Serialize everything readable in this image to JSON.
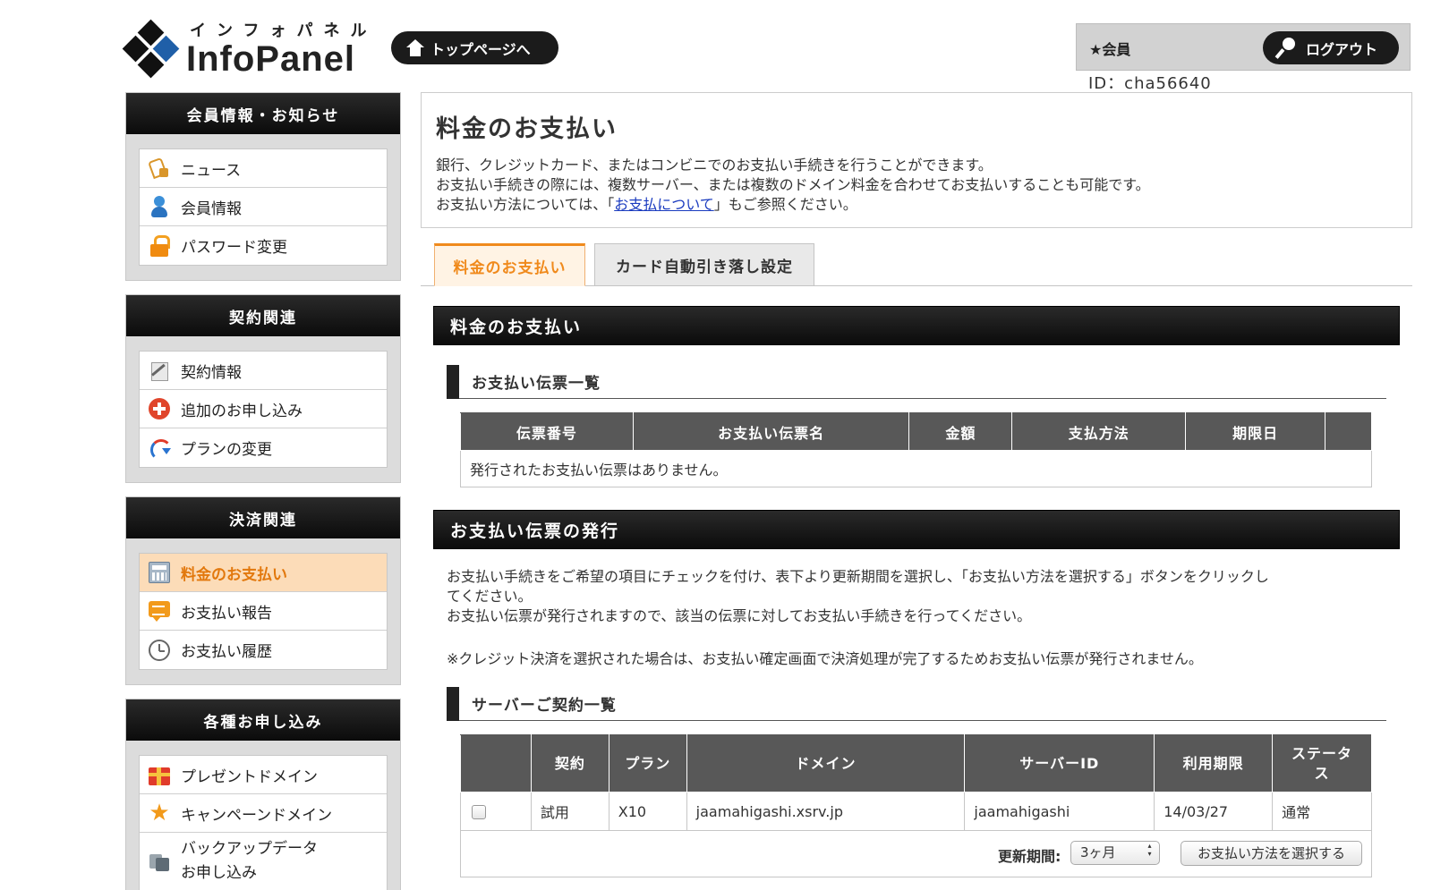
{
  "header": {
    "logo_kana": "インフォパネル",
    "logo_text": "InfoPanel",
    "top_button": "トップページへ",
    "member_label": "★会員",
    "logout_button": "ログアウト",
    "member_id": "ID：cha56640"
  },
  "sidebar": [
    {
      "title": "会員情報・お知らせ",
      "items": [
        {
          "label": "ニュース",
          "icon": "news-icon"
        },
        {
          "label": "会員情報",
          "icon": "user-icon"
        },
        {
          "label": "パスワード変更",
          "icon": "lock-icon"
        }
      ]
    },
    {
      "title": "契約関連",
      "items": [
        {
          "label": "契約情報",
          "icon": "contract-icon"
        },
        {
          "label": "追加のお申し込み",
          "icon": "plus-icon"
        },
        {
          "label": "プランの変更",
          "icon": "swap-icon"
        }
      ]
    },
    {
      "title": "決済関連",
      "items": [
        {
          "label": "料金のお支払い",
          "icon": "calculator-icon",
          "active": true
        },
        {
          "label": "お支払い報告",
          "icon": "chat-icon"
        },
        {
          "label": "お支払い履歴",
          "icon": "clock-icon"
        }
      ]
    },
    {
      "title": "各種お申し込み",
      "items": [
        {
          "label": "プレゼントドメイン",
          "icon": "gift-icon"
        },
        {
          "label": "キャンペーンドメイン",
          "icon": "star-icon"
        },
        {
          "label_line1": "バックアップデータ",
          "label_line2": "お申し込み",
          "icon": "backup-icon"
        }
      ]
    }
  ],
  "intro": {
    "title": "料金のお支払い",
    "line1": "銀行、クレジットカード、またはコンビニでのお支払い手続きを行うことができます。",
    "line2": "お支払い手続きの際には、複数サーバー、または複数のドメイン料金を合わせてお支払いすることも可能です。",
    "line3_before": "お支払い方法については、「",
    "line3_link": "お支払について",
    "line3_after": "」もご参照ください。"
  },
  "tabs": [
    "料金のお支払い",
    "カード自動引き落し設定"
  ],
  "payment_section": {
    "title": "料金のお支払い",
    "subhead": "お支払い伝票一覧",
    "columns": [
      "伝票番号",
      "お支払い伝票名",
      "金額",
      "支払方法",
      "期限日",
      ""
    ],
    "empty_message": "発行されたお支払い伝票はありません。"
  },
  "issue_section": {
    "title": "お支払い伝票の発行",
    "text_line1": "お支払い手続きをご希望の項目にチェックを付け、表下より更新期間を選択し、「お支払い方法を選択する」ボタンをクリックし",
    "text_line2": "てください。",
    "text_line3": "お支払い伝票が発行されますので、該当の伝票に対してお支払い手続きを行ってください。",
    "note": "※クレジット決済を選択された場合は、お支払い確定画面で決済処理が完了するためお支払い伝票が発行されません。",
    "subhead": "サーバーご契約一覧",
    "columns": [
      "",
      "契約",
      "プラン",
      "ドメイン",
      "サーバーID",
      "利用期限",
      "ステータ\nス"
    ],
    "status_header_line1": "ステータ",
    "status_header_line2": "ス",
    "rows": [
      {
        "contract": "試用",
        "plan": "X10",
        "domain": "jaamahigashi.xsrv.jp",
        "server_id": "jaamahigashi",
        "expiry": "14/03/27",
        "status": "通常",
        "checked": false
      }
    ],
    "renew_label": "更新期間:",
    "renew_value": "3ヶ月",
    "select_button": "お支払い方法を選択する"
  },
  "colors": {
    "accent": "#f08a1c",
    "active_bg": "#fcdcb8",
    "header_dark": "#111111",
    "table_header": "#585858",
    "link": "#1a3bbf"
  }
}
